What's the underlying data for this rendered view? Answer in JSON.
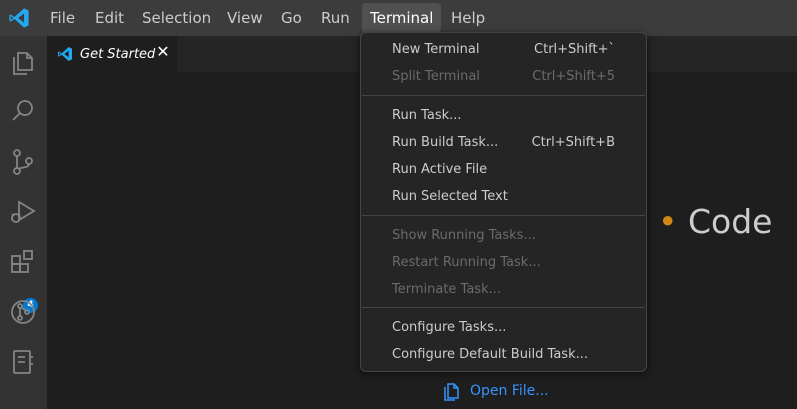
{
  "menubar": {
    "items": [
      {
        "label": "File"
      },
      {
        "label": "Edit"
      },
      {
        "label": "Selection"
      },
      {
        "label": "View"
      },
      {
        "label": "Go"
      },
      {
        "label": "Run"
      },
      {
        "label": "Terminal",
        "active": true
      },
      {
        "label": "Help"
      }
    ]
  },
  "activitybar": {
    "icons": [
      "explorer-icon",
      "search-icon",
      "source-control-icon",
      "run-debug-icon",
      "extensions-icon",
      "git-graph-icon",
      "notebook-icon"
    ],
    "extensions_badge": "4"
  },
  "tab": {
    "title": "Get Started",
    "close_glyph": "✕"
  },
  "editor": {
    "heading_fragment": "Code",
    "open_file_link": "Open File..."
  },
  "terminal_menu": {
    "groups": [
      [
        {
          "label": "New Terminal",
          "shortcut": "Ctrl+Shift+`",
          "enabled": true
        },
        {
          "label": "Split Terminal",
          "shortcut": "Ctrl+Shift+5",
          "enabled": false
        }
      ],
      [
        {
          "label": "Run Task...",
          "shortcut": "",
          "enabled": true
        },
        {
          "label": "Run Build Task...",
          "shortcut": "Ctrl+Shift+B",
          "enabled": true
        },
        {
          "label": "Run Active File",
          "shortcut": "",
          "enabled": true
        },
        {
          "label": "Run Selected Text",
          "shortcut": "",
          "enabled": true
        }
      ],
      [
        {
          "label": "Show Running Tasks...",
          "shortcut": "",
          "enabled": false
        },
        {
          "label": "Restart Running Task...",
          "shortcut": "",
          "enabled": false
        },
        {
          "label": "Terminate Task...",
          "shortcut": "",
          "enabled": false
        }
      ],
      [
        {
          "label": "Configure Tasks...",
          "shortcut": "",
          "enabled": true
        },
        {
          "label": "Configure Default Build Task...",
          "shortcut": "",
          "enabled": true
        }
      ]
    ]
  },
  "colors": {
    "accent": "#0078d4",
    "link": "#3794ff",
    "titlebar": "#3c3c3c",
    "activitybar": "#333333",
    "editor": "#1e1e1e"
  }
}
